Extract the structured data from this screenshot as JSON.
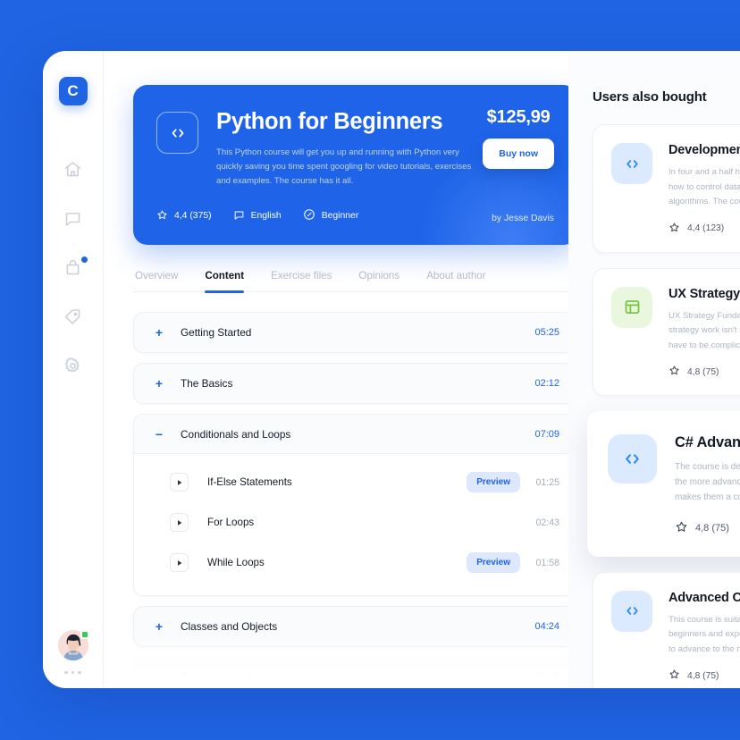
{
  "theme": {
    "page_background": "#2064e4",
    "accent": "#2064e4",
    "hero_background": "#1f64e8",
    "panel_background": "#fbfcfe",
    "badge_blue": "#dde8fd",
    "online_green": "#35cc55"
  },
  "rail": {
    "logo_label": "C",
    "items": [
      {
        "name": "home-icon",
        "label": "Home"
      },
      {
        "name": "chat-icon",
        "label": "Messages"
      },
      {
        "name": "bag-icon",
        "label": "Cart",
        "badge": true
      },
      {
        "name": "tag-icon",
        "label": "Offers"
      },
      {
        "name": "gear-icon",
        "label": "Settings"
      }
    ],
    "more_label": "•••"
  },
  "hero": {
    "icon": "code-icon",
    "title": "Python for Beginners",
    "description": "This Python course will get you up and running with Python very quickly saving you time spent googling for video tutorials, exercises and examples. The course has it all.",
    "price": "$125,99",
    "buy_label": "Buy now",
    "meta": [
      {
        "icon": "star-icon",
        "text": "4,4 (375)"
      },
      {
        "icon": "chat-bubble-icon",
        "text": "English"
      },
      {
        "icon": "gauge-icon",
        "text": "Beginner"
      }
    ],
    "author": "by Jesse Davis"
  },
  "tabs": [
    {
      "label": "Overview",
      "active": false
    },
    {
      "label": "Content",
      "active": true
    },
    {
      "label": "Exercise files",
      "active": false
    },
    {
      "label": "Opinions",
      "active": false
    },
    {
      "label": "About author",
      "active": false
    }
  ],
  "sections": [
    {
      "sign": "+",
      "title": "Getting Started",
      "time": "05:25",
      "open": false,
      "faded": false,
      "lessons": []
    },
    {
      "sign": "+",
      "title": "The Basics",
      "time": "02:12",
      "open": false,
      "faded": false,
      "lessons": []
    },
    {
      "sign": "−",
      "title": "Conditionals and Loops",
      "time": "07:09",
      "open": true,
      "faded": false,
      "lessons": [
        {
          "title": "If-Else Statements",
          "preview": "Preview",
          "time": "01:25"
        },
        {
          "title": "For Loops",
          "preview": "",
          "time": "02:43"
        },
        {
          "title": "While Loops",
          "preview": "Preview",
          "time": "01:58"
        }
      ]
    },
    {
      "sign": "+",
      "title": "Classes and Objects",
      "time": "04:24",
      "open": false,
      "faded": false,
      "lessons": []
    },
    {
      "sign": "+",
      "title": "Graphics and Animatons",
      "time": "06:15",
      "open": false,
      "faded": true,
      "lessons": []
    }
  ],
  "right_panel": {
    "title": "Users also bought",
    "cards": [
      {
        "icon": "code-icon",
        "icon_style": "blue",
        "title": "Development",
        "description_lines": [
          "In four and a half hours you will learn",
          "how to control data structures and",
          "algorithms. The course is for everyone."
        ],
        "rating": "4,4 (123)",
        "elevated": false
      },
      {
        "icon": "layout-icon",
        "icon_style": "green",
        "title": "UX Strategy",
        "description_lines": [
          "UX Strategy Fundamentals shows that",
          "strategy work isn't magic and doesn't",
          "have to be complicated to be effective."
        ],
        "rating": "4,8 (75)",
        "elevated": false
      },
      {
        "icon": "code-icon",
        "icon_style": "blue",
        "title": "C# Advanced",
        "description_lines": [
          "The course is designed for those who",
          "the more advanced side of C# and",
          "makes them a confident developer."
        ],
        "rating": "4,8 (75)",
        "elevated": true
      },
      {
        "icon": "code-icon",
        "icon_style": "blue",
        "title": "Advanced CSS",
        "description_lines": [
          "This course is suitable both for",
          "beginners and experienced who want",
          "to advance to the next level quickly."
        ],
        "rating": "4,8 (75)",
        "elevated": false
      }
    ]
  }
}
